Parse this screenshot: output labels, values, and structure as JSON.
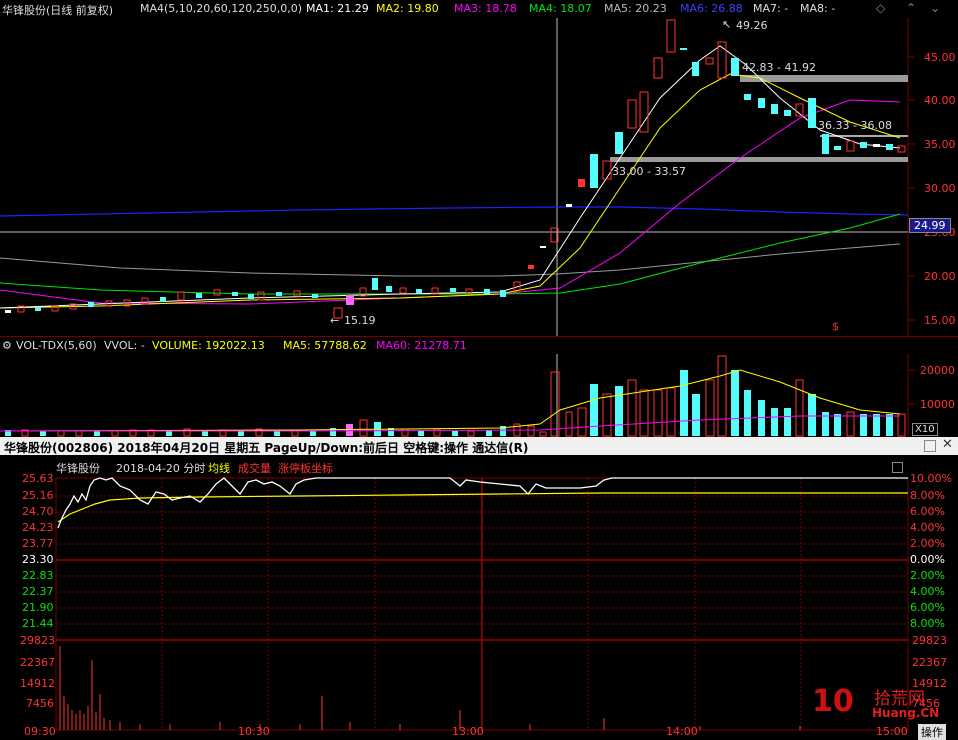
{
  "kline_header": {
    "stock_title": "华锋股份(日线 前复权)",
    "ma_params": "MA4(5,10,20,60,120,250,0,0)",
    "ma1": "MA1: 21.29",
    "ma2": "MA2: 19.80",
    "ma3": "MA3: 18.78",
    "ma4": "MA4: 18.07",
    "ma5": "MA5: 20.23",
    "ma6": "MA6: 26.88",
    "ma7": "MA7: -",
    "ma8": "MA8: -"
  },
  "kline_price_axis": [
    "45.00",
    "40.00",
    "35.00",
    "30.00",
    "25.00",
    "20.00",
    "15.00"
  ],
  "kline_annotations": {
    "high": "49.26",
    "low": "15.19",
    "cursor_price": "24.99",
    "band1": "42.83 - 41.92",
    "band2": "36.33 - 36.08",
    "band3": "33.00 - 33.57",
    "dollar": "$"
  },
  "volume_header": {
    "indicator": "VOL-TDX(5,60)",
    "vvol": "VVOL: -",
    "volume": "VOLUME: 192022.13",
    "ma5": "MA5: 57788.62",
    "ma60": "MA60: 21278.71"
  },
  "volume_axis": [
    "20000",
    "10000"
  ],
  "volume_unit": "X10",
  "intraday_title_bar": "华锋股份(002806)  2018年04月20日 星期五 PageUp/Down:前后日 空格键:操作 通达信(R)",
  "intraday_header": {
    "name": "华锋股份",
    "date": "2018-04-20 分时",
    "avg_line": "均线",
    "volume": "成交量",
    "limit_coord": "涨停板坐标"
  },
  "intraday_left_axis": [
    "25.63",
    "25.16",
    "24.70",
    "24.23",
    "23.77",
    "23.30",
    "22.83",
    "22.37",
    "21.90",
    "21.44"
  ],
  "intraday_right_axis": [
    "10.00%",
    "8.00%",
    "6.00%",
    "4.00%",
    "2.00%",
    "0.00%",
    "2.00%",
    "4.00%",
    "6.00%",
    "8.00%"
  ],
  "intraday_vol_axis": [
    "29823",
    "22367",
    "14912",
    "7456"
  ],
  "intraday_time_axis": [
    "09:30",
    "10:30",
    "13:00",
    "14:00",
    "15:00"
  ],
  "ops_label": "操作",
  "watermark": {
    "number": "10",
    "brand": "拾荒网",
    "url": "Huang.CN"
  },
  "colors": {
    "up": "#ff3232",
    "down": "#54fcfc",
    "ma1": "#ffffff",
    "ma2": "#ffff00",
    "ma3": "#ff00ff",
    "ma4": "#00e600",
    "ma5": "#999999",
    "ma6": "#2020ff"
  }
}
